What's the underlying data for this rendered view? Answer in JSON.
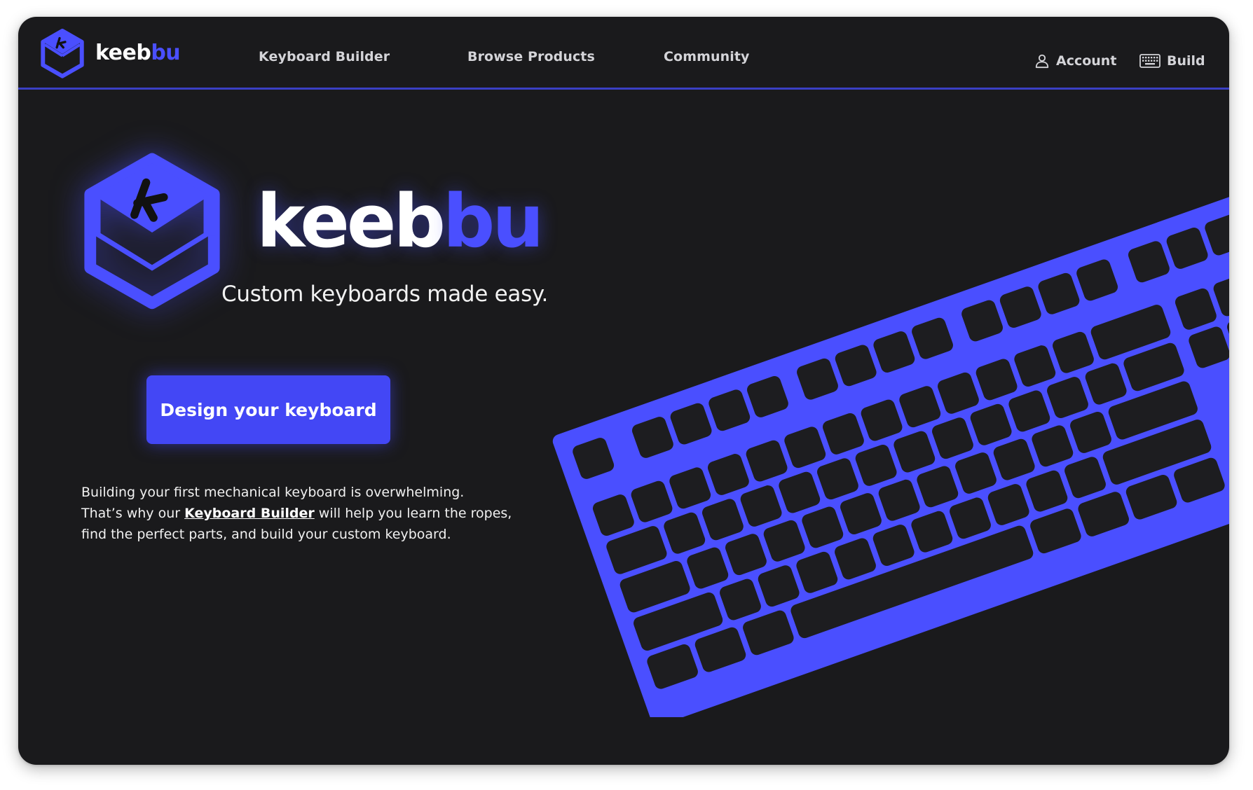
{
  "brand": {
    "name_part1": "keeb",
    "name_part2": "bu"
  },
  "nav": {
    "links": [
      {
        "label": "Keyboard Builder"
      },
      {
        "label": "Browse Products"
      },
      {
        "label": "Community"
      }
    ],
    "account_label": "Account",
    "build_label": "Build"
  },
  "hero": {
    "title_part1": "keeb",
    "title_part2": "bu",
    "tagline": "Custom keyboards made easy.",
    "cta_label": "Design your keyboard",
    "description": {
      "line1": "Building your first mechanical keyboard is overwhelming.",
      "line2_before": "That’s why our ",
      "line2_link": "Keyboard Builder",
      "line2_after": " will help you learn the ropes,",
      "line3": "find the perfect parts, and build your custom keyboard."
    }
  },
  "icons": {
    "logo": "keebbu-keycap-logo-icon",
    "account": "user-icon",
    "build": "keyboard-icon"
  },
  "colors": {
    "background": "#1a1a1c",
    "accent": "#4347f5",
    "keyboard_case": "#4a4fff",
    "keycap": "#1d1d20",
    "nav_text": "#d4d4d8"
  }
}
